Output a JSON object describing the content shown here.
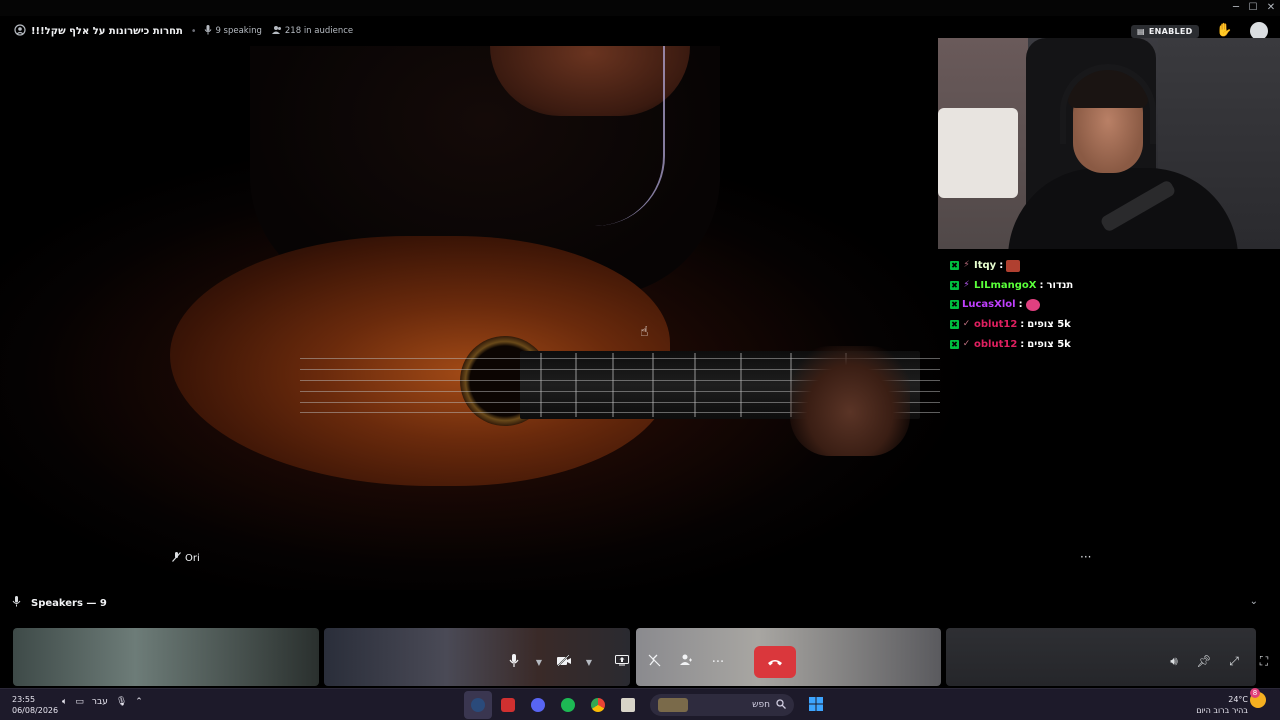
{
  "window": {
    "minimize_icon": "minimize-icon",
    "maximize_icon": "maximize-icon",
    "close_icon": "close-icon"
  },
  "header": {
    "title": "תחרות כישרונות על אלף שקל!!!",
    "speaking": "9 speaking",
    "audience": "218 in audience",
    "enabled_label": "ENABLED"
  },
  "main_video": {
    "participant_name": "Ori"
  },
  "chat": [
    {
      "user": "Itqy",
      "user_color": "#b7ff3c",
      "message": "",
      "emote_color": "#b04030",
      "second_badge": "⚡"
    },
    {
      "user": "LILmangoX",
      "user_color": "#5aff3a",
      "message": "תנדור",
      "emote_color": "",
      "second_badge": "⚡"
    },
    {
      "user": "LucasXlol",
      "user_color": "#c040ff",
      "message": "",
      "emote_color": "#e04080",
      "second_badge": ""
    },
    {
      "user": "oblut12",
      "user_color": "#e02060",
      "message": "5k צופים",
      "emote_color": "",
      "second_badge": "✓"
    },
    {
      "user": "oblut12",
      "user_color": "#e02060",
      "message": "5k צופים",
      "emote_color": "",
      "second_badge": "✓"
    }
  ],
  "speakers": {
    "label": "Speakers — 9"
  },
  "taskbar": {
    "time": "23:55",
    "date": "06/08/2026",
    "language": "עבר",
    "search_placeholder": "חפש",
    "temperature": "24°C",
    "weather_text": "בהיר ברוב היום",
    "notification_count": "8"
  },
  "colors": {
    "end_call": "#da373c",
    "background": "#000000",
    "taskbar": "#1d1a2a"
  }
}
